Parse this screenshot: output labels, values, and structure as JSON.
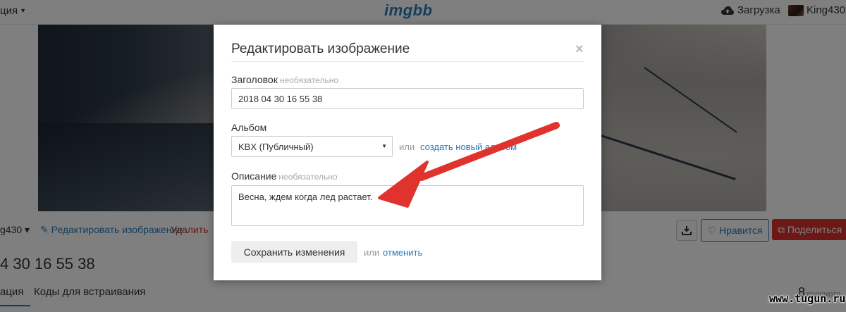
{
  "topbar": {
    "left_menu": "ция",
    "logo": "imgbb",
    "upload": "Загрузка",
    "username": "King430"
  },
  "page": {
    "owner": "g430",
    "edit_link": "Редактировать изображение",
    "delete_link": "Удалить",
    "image_title": "4 30 16 55 38",
    "tab_active": "ация",
    "tab_embed": "Коды для встраивания",
    "like_button": "Нравится",
    "share_button": "Поделиться",
    "views_count": "8",
    "views_label": "просмотр"
  },
  "modal": {
    "title": "Редактировать изображение",
    "close": "×",
    "title_label": "Заголовок",
    "optional": "необязательно",
    "title_value": "2018 04 30 16 55 38",
    "album_label": "Альбом",
    "album_value": "KBX (Публичный)",
    "or": "или",
    "create_album": "создать новый альбом",
    "description_label": "Описание",
    "description_value": "Весна, ждем когда лед растает.",
    "save_button": "Сохранить изменения",
    "cancel": "отменить"
  },
  "watermark": "www.tugun.ru",
  "colors": {
    "accent": "#2a7ab8",
    "danger": "#d9302f",
    "arrow": "#e0332e"
  }
}
